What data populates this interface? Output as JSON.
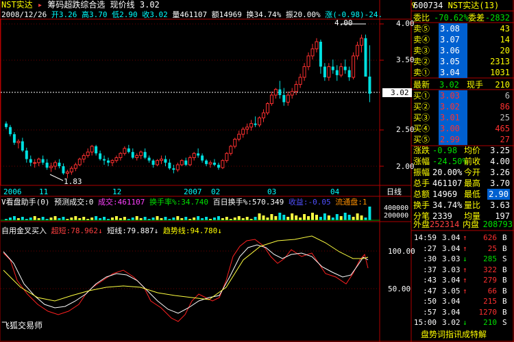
{
  "header": {
    "title": "NST实达",
    "arrow": "▸",
    "formula": "筹码超跌综合选",
    "price_line": "现价线 3.02",
    "date": "2008/12/26",
    "open": "开3.26",
    "high": "高3.70",
    "low": "低2.90",
    "close": "收3.02",
    "vol": "量461107",
    "amt": "额14969",
    "turn": "换34.74%",
    "amp": "振20.00%",
    "chg": "涨(-0.98)-24."
  },
  "corner_symbol": "♀",
  "price_axis": [
    "4.00",
    "3.50",
    "3.02",
    "2.50",
    "2.00"
  ],
  "annotations": {
    "high": "4.00",
    "low": "1.83"
  },
  "time_axis": [
    "2006",
    "11",
    "12",
    "2007",
    "02",
    "03",
    "04",
    "日线"
  ],
  "volume_bar": {
    "title": "V看盘助手(0)",
    "pred": "预测成交:0",
    "vol": "成交:461107",
    "turn": "换手率%:34.740",
    "turn100": "百日换手%:570.349",
    "gain": "收益:-0.05",
    "flow": "流通盘:1",
    "axis": [
      "400000",
      "200000"
    ]
  },
  "indicator": {
    "title": "自用金叉买入",
    "a": "超短:78.962",
    "b": "短线:79.887",
    "c": "趋势线:94.780",
    "axis": [
      "100.00",
      "50.00"
    ],
    "footer": "飞狐交易师"
  },
  "quote": {
    "code": "600734",
    "name": "NST实达",
    "count": "(13)",
    "wei_bi_label": "委比",
    "wei_bi": "-70.62%",
    "wei_cha_label": "委差",
    "wei_cha": "-2832",
    "sells": [
      {
        "n": "卖⑤",
        "p": "3.08",
        "v": "43"
      },
      {
        "n": "卖④",
        "p": "3.07",
        "v": "14"
      },
      {
        "n": "卖③",
        "p": "3.06",
        "v": "20"
      },
      {
        "n": "卖②",
        "p": "3.05",
        "v": "2313"
      },
      {
        "n": "卖①",
        "p": "3.04",
        "v": "1031"
      }
    ],
    "latest_label": "最新",
    "latest": "3.02",
    "cur_label": "现手",
    "cur": "210",
    "buys": [
      {
        "n": "买①",
        "p": "3.03",
        "v": "6"
      },
      {
        "n": "买②",
        "p": "3.02",
        "v": "86"
      },
      {
        "n": "买③",
        "p": "3.01",
        "v": "25"
      },
      {
        "n": "买④",
        "p": "3.00",
        "v": "465"
      },
      {
        "n": "买⑤",
        "p": "2.99",
        "v": "27"
      }
    ],
    "stats": [
      {
        "l1": "涨跌",
        "v1": "-0.98",
        "l2": "均价",
        "v2": "3.25"
      },
      {
        "l1": "涨幅",
        "v1": "-24.50%",
        "l2": "前收",
        "v2": "4.00"
      },
      {
        "l1": "振幅",
        "v1": "20.00%",
        "l2": "今开",
        "v2": "3.26"
      },
      {
        "l1": "总手",
        "v1": "461107",
        "l2": "最高",
        "v2": "3.70"
      },
      {
        "l1": "总额",
        "v1": "14969",
        "l2": "最低",
        "v2": "2.90"
      },
      {
        "l1": "换手",
        "v1": "34.74%",
        "l2": "量比",
        "v2": "3.63"
      },
      {
        "l1": "分笔",
        "v1": "2339",
        "l2": "均量",
        "v2": "197"
      }
    ],
    "outer_label": "外盘",
    "outer": "252314",
    "inner_label": "内盘",
    "inner": "208793",
    "ticks": [
      {
        "t": "14:59",
        "p": "3.04",
        "d": "↑",
        "v": "626",
        "s": "B"
      },
      {
        "t": ":27",
        "p": "3.04",
        "d": "↑",
        "v": "25",
        "s": "B"
      },
      {
        "t": ":30",
        "p": "3.03",
        "d": "↓",
        "v": "285",
        "s": "S"
      },
      {
        "t": ":37",
        "p": "3.03",
        "d": "↑",
        "v": "322",
        "s": "B"
      },
      {
        "t": ":43",
        "p": "3.04",
        "d": "↑",
        "v": "279",
        "s": "B"
      },
      {
        "t": ":47",
        "p": "3.05",
        "d": "↑",
        "v": "66",
        "s": "B"
      },
      {
        "t": ":50",
        "p": "3.04",
        "d": " ",
        "v": "215",
        "s": "B"
      },
      {
        "t": ":57",
        "p": "3.04",
        "d": " ",
        "v": "1270",
        "s": "B"
      },
      {
        "t": "15:00",
        "p": "3.02",
        "d": "↓",
        "v": "210",
        "s": "S"
      }
    ],
    "bottom": "盘势词指讯成特解"
  },
  "chart_data": {
    "type": "candlestick",
    "title": "NST实达",
    "ylim": [
      1.8,
      4.2
    ],
    "candles": [
      [
        2.6,
        2.63,
        2.52,
        2.55
      ],
      [
        2.55,
        2.58,
        2.42,
        2.45
      ],
      [
        2.45,
        2.48,
        2.3,
        2.33
      ],
      [
        2.33,
        2.38,
        2.25,
        2.35
      ],
      [
        2.35,
        2.4,
        2.2,
        2.22
      ],
      [
        2.22,
        2.26,
        2.05,
        2.1
      ],
      [
        2.1,
        2.15,
        2.0,
        2.05
      ],
      [
        2.05,
        2.1,
        1.98,
        2.05
      ],
      [
        2.05,
        2.12,
        2.0,
        2.1
      ],
      [
        2.1,
        2.15,
        2.02,
        2.05
      ],
      [
        2.05,
        2.1,
        1.95,
        1.98
      ],
      [
        1.98,
        2.05,
        1.92,
        2.0
      ],
      [
        2.0,
        2.08,
        1.95,
        2.05
      ],
      [
        2.05,
        2.1,
        1.97,
        2.0
      ],
      [
        2.0,
        2.04,
        1.88,
        1.9
      ],
      [
        1.9,
        1.95,
        1.83,
        1.92
      ],
      [
        1.92,
        2.0,
        1.88,
        1.97
      ],
      [
        1.97,
        2.05,
        1.93,
        2.02
      ],
      [
        2.02,
        2.12,
        2.0,
        2.1
      ],
      [
        2.1,
        2.18,
        2.05,
        2.15
      ],
      [
        2.15,
        2.25,
        2.12,
        2.2
      ],
      [
        2.2,
        2.3,
        2.15,
        2.28
      ],
      [
        2.28,
        2.3,
        2.15,
        2.18
      ],
      [
        2.18,
        2.22,
        2.08,
        2.1
      ],
      [
        2.1,
        2.15,
        2.02,
        2.08
      ],
      [
        2.08,
        2.12,
        2.0,
        2.05
      ],
      [
        2.05,
        2.1,
        2.0,
        2.08
      ],
      [
        2.08,
        2.15,
        2.05,
        2.12
      ],
      [
        2.12,
        2.2,
        2.08,
        2.18
      ],
      [
        2.18,
        2.28,
        2.15,
        2.25
      ],
      [
        2.25,
        2.3,
        2.18,
        2.2
      ],
      [
        2.2,
        2.25,
        2.1,
        2.12
      ],
      [
        2.12,
        2.18,
        2.08,
        2.15
      ],
      [
        2.15,
        2.22,
        2.1,
        2.2
      ],
      [
        2.2,
        2.25,
        2.1,
        2.12
      ],
      [
        2.12,
        2.15,
        2.05,
        2.08
      ],
      [
        2.08,
        2.1,
        1.98,
        2.02
      ],
      [
        2.02,
        2.1,
        2.0,
        2.08
      ],
      [
        2.08,
        2.15,
        2.03,
        2.1
      ],
      [
        2.1,
        2.15,
        2.0,
        2.05
      ],
      [
        2.05,
        2.1,
        1.95,
        1.97
      ],
      [
        1.97,
        2.02,
        1.9,
        1.95
      ],
      [
        1.95,
        2.05,
        1.92,
        2.02
      ],
      [
        2.02,
        2.1,
        2.0,
        2.08
      ],
      [
        2.08,
        2.12,
        2.0,
        2.02
      ],
      [
        2.02,
        2.15,
        2.0,
        2.12
      ],
      [
        2.12,
        2.2,
        2.08,
        2.18
      ],
      [
        2.18,
        2.25,
        2.12,
        2.15
      ],
      [
        2.15,
        2.18,
        2.05,
        2.08
      ],
      [
        2.08,
        2.1,
        2.0,
        2.03
      ],
      [
        2.03,
        2.08,
        1.98,
        2.05
      ],
      [
        2.05,
        2.1,
        2.0,
        2.02
      ],
      [
        2.02,
        2.05,
        1.95,
        1.98
      ],
      [
        1.98,
        2.1,
        1.96,
        2.08
      ],
      [
        2.08,
        2.2,
        2.05,
        2.18
      ],
      [
        2.18,
        2.3,
        2.15,
        2.28
      ],
      [
        2.28,
        2.4,
        2.25,
        2.38
      ],
      [
        2.38,
        2.5,
        2.35,
        2.45
      ],
      [
        2.45,
        2.55,
        2.4,
        2.52
      ],
      [
        2.52,
        2.6,
        2.45,
        2.55
      ],
      [
        2.55,
        2.65,
        2.5,
        2.6
      ],
      [
        2.6,
        2.7,
        2.55,
        2.58
      ],
      [
        2.58,
        2.7,
        2.55,
        2.68
      ],
      [
        2.68,
        2.8,
        2.62,
        2.75
      ],
      [
        2.75,
        2.9,
        2.72,
        2.88
      ],
      [
        2.88,
        3.05,
        2.85,
        3.0
      ],
      [
        3.0,
        3.1,
        2.95,
        3.08
      ],
      [
        3.08,
        3.2,
        2.95,
        3.0
      ],
      [
        3.0,
        3.1,
        2.85,
        2.9
      ],
      [
        2.9,
        3.05,
        2.85,
        3.0
      ],
      [
        3.0,
        3.1,
        2.95,
        3.05
      ],
      [
        3.05,
        3.2,
        3.0,
        3.15
      ],
      [
        3.15,
        3.3,
        3.1,
        3.25
      ],
      [
        3.25,
        3.45,
        3.2,
        3.4
      ],
      [
        3.4,
        3.6,
        3.35,
        3.55
      ],
      [
        3.55,
        3.72,
        3.5,
        3.65
      ],
      [
        3.65,
        3.8,
        3.6,
        3.75
      ],
      [
        3.75,
        3.78,
        3.3,
        3.4
      ],
      [
        3.4,
        3.45,
        3.2,
        3.25
      ],
      [
        3.25,
        3.45,
        3.2,
        3.4
      ],
      [
        3.4,
        3.5,
        3.3,
        3.35
      ],
      [
        3.35,
        3.42,
        3.2,
        3.28
      ],
      [
        3.28,
        3.45,
        3.25,
        3.4
      ],
      [
        3.4,
        3.5,
        3.3,
        3.35
      ],
      [
        3.35,
        3.4,
        3.2,
        3.25
      ],
      [
        3.25,
        3.6,
        3.22,
        3.55
      ],
      [
        3.55,
        3.75,
        3.5,
        3.7
      ],
      [
        3.7,
        3.85,
        3.6,
        3.8
      ],
      [
        3.8,
        3.85,
        3.26,
        3.26
      ],
      [
        3.26,
        3.7,
        2.9,
        3.02
      ]
    ]
  }
}
